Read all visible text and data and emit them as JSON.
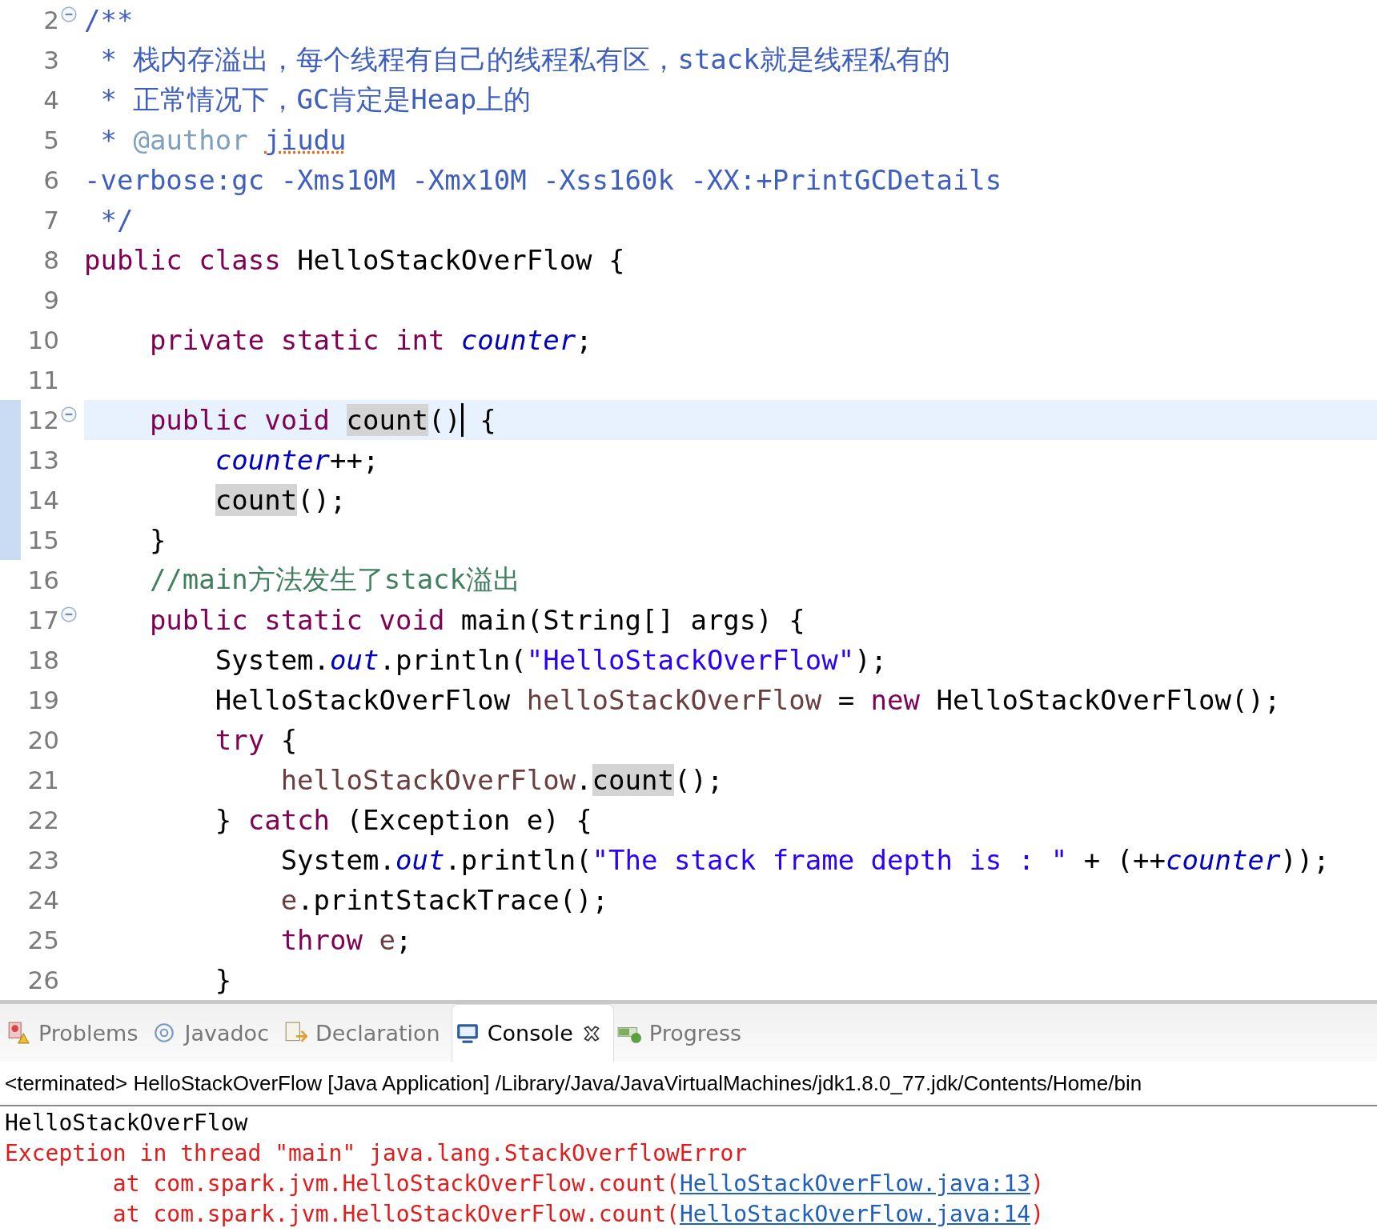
{
  "editor": {
    "lines": [
      {
        "number": "2",
        "foldable": true,
        "current": false,
        "changed": false,
        "tokens": [
          {
            "t": "/**",
            "kind": "doc"
          }
        ]
      },
      {
        "number": "3",
        "foldable": false,
        "current": false,
        "changed": false,
        "tokens": [
          {
            "t": " * 栈内存溢出，每个线程有自己的线程私有区，stack就是线程私有的",
            "kind": "doc"
          }
        ]
      },
      {
        "number": "4",
        "foldable": false,
        "current": false,
        "changed": false,
        "tokens": [
          {
            "t": " * 正常情况下，GC肯定是Heap上的",
            "kind": "doc"
          }
        ]
      },
      {
        "number": "5",
        "foldable": false,
        "current": false,
        "changed": false,
        "tokens": [
          {
            "t": " * ",
            "kind": "doc"
          },
          {
            "t": "@author ",
            "kind": "tag"
          },
          {
            "t": "jiudu",
            "kind": "misspelled"
          }
        ]
      },
      {
        "number": "6",
        "foldable": false,
        "current": false,
        "changed": false,
        "tokens": [
          {
            "t": "-verbose:gc -Xms10M -Xmx10M -Xss160k -XX:+PrintGCDetails",
            "kind": "doc"
          }
        ]
      },
      {
        "number": "7",
        "foldable": false,
        "current": false,
        "changed": false,
        "tokens": [
          {
            "t": " */",
            "kind": "doc"
          }
        ]
      },
      {
        "number": "8",
        "foldable": false,
        "current": false,
        "changed": false,
        "tokens": [
          {
            "t": "public class",
            "kind": "kw"
          },
          {
            "t": " HelloStackOverFlow {",
            "kind": "plain"
          }
        ]
      },
      {
        "number": "9",
        "foldable": false,
        "current": false,
        "changed": false
      },
      {
        "number": "10",
        "foldable": false,
        "current": false,
        "changed": false,
        "tokens": [
          {
            "t": "    private static int ",
            "kind": "kw"
          },
          {
            "t": "counter",
            "kind": "field"
          },
          {
            "t": ";",
            "kind": "plain"
          }
        ]
      },
      {
        "number": "11",
        "foldable": false,
        "current": false,
        "changed": false
      },
      {
        "number": "12",
        "foldable": true,
        "current": true,
        "changed": true,
        "tokens": [
          {
            "t": "    public void ",
            "kind": "kw"
          },
          {
            "t": "count",
            "kind": "occurrence"
          },
          {
            "t": "()",
            "kind": "plain",
            "caret": true
          },
          {
            "t": " {",
            "kind": "plain"
          }
        ]
      },
      {
        "number": "13",
        "foldable": false,
        "current": false,
        "changed": true,
        "tokens": [
          {
            "t": "        counter",
            "kind": "field"
          },
          {
            "t": "++;",
            "kind": "plain"
          }
        ]
      },
      {
        "number": "14",
        "foldable": false,
        "current": false,
        "changed": true,
        "tokens": [
          {
            "t": "        count",
            "kind": "occurrence"
          },
          {
            "t": "();",
            "kind": "plain"
          }
        ]
      },
      {
        "number": "15",
        "foldable": false,
        "current": false,
        "changed": true,
        "tokens": [
          {
            "t": "    }",
            "kind": "plain"
          }
        ]
      },
      {
        "number": "16",
        "foldable": false,
        "current": false,
        "changed": false,
        "tokens": [
          {
            "t": "    //main方法发生了stack溢出",
            "kind": "comment"
          }
        ]
      },
      {
        "number": "17",
        "foldable": true,
        "current": false,
        "changed": false,
        "tokens": [
          {
            "t": "    public static void",
            "kind": "kw"
          },
          {
            "t": " main(String[] args) {",
            "kind": "plain"
          }
        ]
      },
      {
        "number": "18",
        "foldable": false,
        "current": false,
        "changed": false,
        "tokens": [
          {
            "t": "        System.",
            "kind": "plain"
          },
          {
            "t": "out",
            "kind": "field"
          },
          {
            "t": ".println(",
            "kind": "plain"
          },
          {
            "t": "\"HelloStackOverFlow\"",
            "kind": "string"
          },
          {
            "t": ");",
            "kind": "plain"
          }
        ]
      },
      {
        "number": "19",
        "foldable": false,
        "current": false,
        "changed": false,
        "tokens": [
          {
            "t": "        HelloStackOverFlow ",
            "kind": "plain"
          },
          {
            "t": "helloStackOverFlow",
            "kind": "local"
          },
          {
            "t": " = ",
            "kind": "plain"
          },
          {
            "t": "new",
            "kind": "kw"
          },
          {
            "t": " HelloStackOverFlow();",
            "kind": "plain"
          }
        ]
      },
      {
        "number": "20",
        "foldable": false,
        "current": false,
        "changed": false,
        "tokens": [
          {
            "t": "        try",
            "kind": "kw"
          },
          {
            "t": " {",
            "kind": "plain"
          }
        ]
      },
      {
        "number": "21",
        "foldable": false,
        "current": false,
        "changed": false,
        "tokens": [
          {
            "t": "            helloStackOverFlow",
            "kind": "local"
          },
          {
            "t": ".",
            "kind": "plain"
          },
          {
            "t": "count",
            "kind": "occurrence"
          },
          {
            "t": "();",
            "kind": "plain"
          }
        ]
      },
      {
        "number": "22",
        "foldable": false,
        "current": false,
        "changed": false,
        "tokens": [
          {
            "t": "        } ",
            "kind": "plain"
          },
          {
            "t": "catch",
            "kind": "kw"
          },
          {
            "t": " (Exception e) {",
            "kind": "plain"
          }
        ]
      },
      {
        "number": "23",
        "foldable": false,
        "current": false,
        "changed": false,
        "tokens": [
          {
            "t": "            System.",
            "kind": "plain"
          },
          {
            "t": "out",
            "kind": "field"
          },
          {
            "t": ".println(",
            "kind": "plain"
          },
          {
            "t": "\"The stack frame depth is : \"",
            "kind": "string"
          },
          {
            "t": " + (++",
            "kind": "plain"
          },
          {
            "t": "counter",
            "kind": "field"
          },
          {
            "t": "));",
            "kind": "plain"
          }
        ]
      },
      {
        "number": "24",
        "foldable": false,
        "current": false,
        "changed": false,
        "tokens": [
          {
            "t": "            e",
            "kind": "local"
          },
          {
            "t": ".printStackTrace();",
            "kind": "plain"
          }
        ]
      },
      {
        "number": "25",
        "foldable": false,
        "current": false,
        "changed": false,
        "tokens": [
          {
            "t": "            throw ",
            "kind": "kw"
          },
          {
            "t": "e",
            "kind": "local"
          },
          {
            "t": ";",
            "kind": "plain"
          }
        ]
      },
      {
        "number": "26",
        "foldable": false,
        "current": false,
        "changed": false,
        "tokens": [
          {
            "t": "        }",
            "kind": "plain"
          }
        ]
      }
    ]
  },
  "tabs": [
    {
      "label": "Problems",
      "kind": "problems",
      "selected": false
    },
    {
      "label": "Javadoc",
      "kind": "javadoc",
      "selected": false
    },
    {
      "label": "Declaration",
      "kind": "declaration",
      "selected": false
    },
    {
      "label": "Console",
      "kind": "console",
      "selected": true
    },
    {
      "label": "Progress",
      "kind": "progress",
      "selected": false
    }
  ],
  "console": {
    "header": "<terminated> HelloStackOverFlow [Java Application] /Library/Java/JavaVirtualMachines/jdk1.8.0_77.jdk/Contents/Home/bin",
    "lines": [
      {
        "kind": "out",
        "parts": [
          {
            "t": "HelloStackOverFlow",
            "link": false
          }
        ]
      },
      {
        "kind": "err",
        "parts": [
          {
            "t": "Exception in thread \"main\" java.lang.StackOverflowError",
            "link": false
          }
        ]
      },
      {
        "kind": "err",
        "parts": [
          {
            "t": "        at com.spark.jvm.HelloStackOverFlow.count(",
            "link": false
          },
          {
            "t": "HelloStackOverFlow.java:13",
            "link": true
          },
          {
            "t": ")",
            "link": false
          }
        ]
      },
      {
        "kind": "err",
        "parts": [
          {
            "t": "        at com.spark.jvm.HelloStackOverFlow.count(",
            "link": false
          },
          {
            "t": "HelloStackOverFlow.java:14",
            "link": true
          },
          {
            "t": ")",
            "link": false
          }
        ]
      }
    ]
  }
}
